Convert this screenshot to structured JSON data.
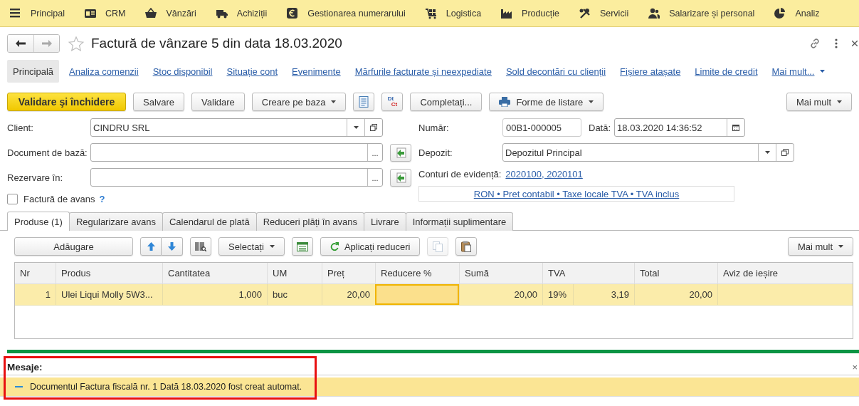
{
  "menu": [
    {
      "label": "Principal"
    },
    {
      "label": "CRM"
    },
    {
      "label": "Vânzări"
    },
    {
      "label": "Achiziții"
    },
    {
      "label": "Gestionarea numerarului"
    },
    {
      "label": "Logistica"
    },
    {
      "label": "Producție"
    },
    {
      "label": "Servicii"
    },
    {
      "label": "Salarizare și personal"
    },
    {
      "label": "Analiz"
    }
  ],
  "window": {
    "title": "Factură de vânzare 5 din data 18.03.2020",
    "favorite": false
  },
  "nav": [
    {
      "label": "Principală",
      "selected": true
    },
    {
      "label": "Analiza comenzii",
      "selected": false
    },
    {
      "label": "Stoc disponibil",
      "selected": false
    },
    {
      "label": "Situație cont",
      "selected": false
    },
    {
      "label": "Evenimente",
      "selected": false
    },
    {
      "label": "Mărfurile facturate și neexpediate",
      "selected": false
    },
    {
      "label": "Sold decontări cu clienții",
      "selected": false
    },
    {
      "label": "Fișiere atașate",
      "selected": false
    },
    {
      "label": "Limite de credit",
      "selected": false
    },
    {
      "label": "Mai mult...",
      "selected": false,
      "kind": "more"
    }
  ],
  "toolbar": [
    {
      "kind": "primary",
      "label": "Validare şi închidere"
    },
    {
      "kind": "button",
      "label": "Salvare"
    },
    {
      "kind": "button",
      "label": "Validare"
    },
    {
      "kind": "menu",
      "label": "Creare pe baza"
    },
    {
      "kind": "icon"
    },
    {
      "kind": "dtct",
      "top": "Dt",
      "bottom": "Ct"
    },
    {
      "kind": "button",
      "label": "Completați..."
    },
    {
      "kind": "print",
      "label": "Forme de listare"
    },
    {
      "kind": "more",
      "label": "Mai mult"
    }
  ],
  "fields_left": [
    {
      "label": "Client:",
      "value": "CINDRU SRL",
      "kind": "dropdown"
    },
    {
      "label": "Document de bază:",
      "kind": "choice",
      "choice_glyph": "..."
    },
    {
      "label": "Rezervare în:",
      "kind": "choice",
      "choice_glyph": "..."
    }
  ],
  "advance_invoice": {
    "label": "Factură de avans",
    "checked": false,
    "help": "?"
  },
  "number": {
    "label": "Număr:",
    "value": "00B1-000005"
  },
  "date": {
    "label": "Dată:",
    "value": "18.03.2020 14:36:52"
  },
  "warehouse": {
    "label": "Depozit:",
    "value": "Depozitul Principal"
  },
  "accounts": {
    "label": "Conturi de evidență:",
    "link": "2020100, 2020101"
  },
  "price_settings": {
    "link": "RON • Pret contabil • Taxe locale TVA • TVA inclus"
  },
  "tabs": [
    {
      "label": "Produse (1)",
      "selected": true
    },
    {
      "label": "Regularizare avans",
      "selected": false
    },
    {
      "label": "Calendarul de plată",
      "selected": false
    },
    {
      "label": "Reduceri plăți în avans",
      "selected": false
    },
    {
      "label": "Livrare",
      "selected": false
    },
    {
      "label": "Informații suplimentare",
      "selected": false
    }
  ],
  "table_toolbar": [
    {
      "kind": "button",
      "label": "Adăugare"
    },
    {
      "kind": "updown"
    },
    {
      "kind": "barcode"
    },
    {
      "kind": "menu",
      "label": "Selectați"
    },
    {
      "kind": "sheet"
    },
    {
      "kind": "refresh",
      "label": "Aplicați reduceri"
    },
    {
      "kind": "copy",
      "disabled": true
    },
    {
      "kind": "paste",
      "disabled": false
    },
    {
      "kind": "more",
      "label": "Mai mult"
    }
  ],
  "table": {
    "columns": [
      "Nr",
      "Produs",
      "Cantitatea",
      "UM",
      "Preț",
      "Reducere %",
      "Sumă",
      "TVA",
      "Total",
      "Aviz de ieșire"
    ],
    "rows": [
      {
        "selected": true,
        "discount_focused": true,
        "nr": "1",
        "product": "Ulei Liqui Molly 5W3...",
        "quantity": "1,000",
        "unit": "buc",
        "price": "20,00",
        "amount": "20,00",
        "vat_rate": "19%",
        "vat_amount": "3,19",
        "total": "20,00"
      }
    ]
  },
  "messages": {
    "title": "Mesaje:",
    "close": "×",
    "highlighted": true,
    "items": [
      {
        "text": "Documentul Factura fiscală nr. 1 Dată 18.03.2020 fost creat automat."
      }
    ]
  }
}
